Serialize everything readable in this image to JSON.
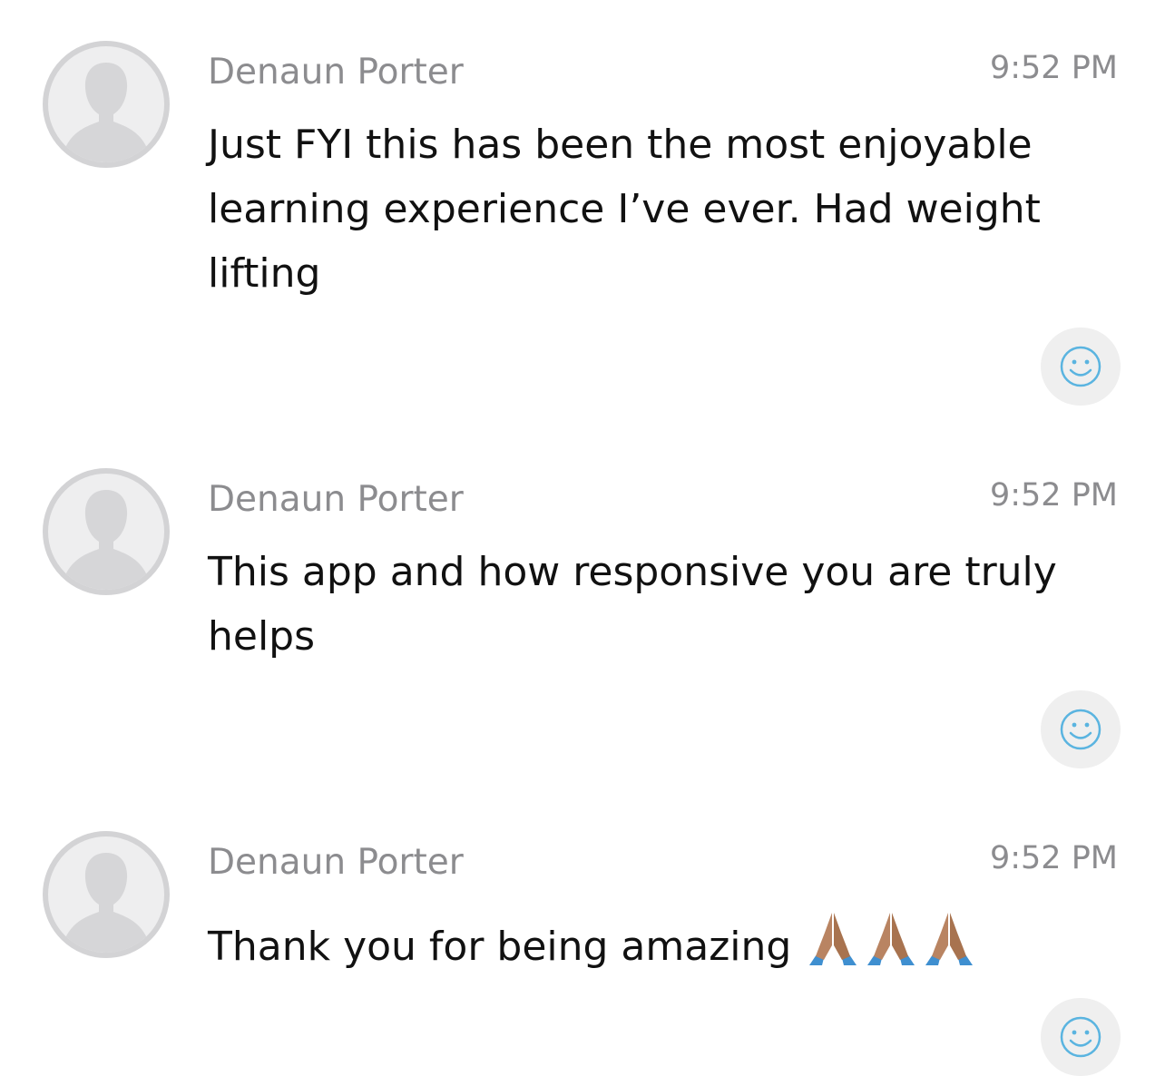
{
  "messages": [
    {
      "sender": "Denaun Porter",
      "time": "9:52 PM",
      "text": "Just FYI this has been the most enjoyable learning experience I’ve ever. Had weight lifting"
    },
    {
      "sender": "Denaun Porter",
      "time": "9:52 PM",
      "text": "This app and how responsive you are truly helps"
    },
    {
      "sender": "Denaun Porter",
      "time": "9:52 PM",
      "text": "Thank you for being amazing",
      "emoji": [
        "folded-hands",
        "folded-hands",
        "folded-hands"
      ]
    }
  ],
  "icons": {
    "avatar": "default-user-silhouette",
    "reaction": "smiley-face-icon"
  },
  "colors": {
    "sender": "#8c8c8f",
    "text": "#111111",
    "avatar_border": "#d3d3d5",
    "reaction_icon": "#5ab4e0",
    "reaction_bg": "#efefef"
  }
}
